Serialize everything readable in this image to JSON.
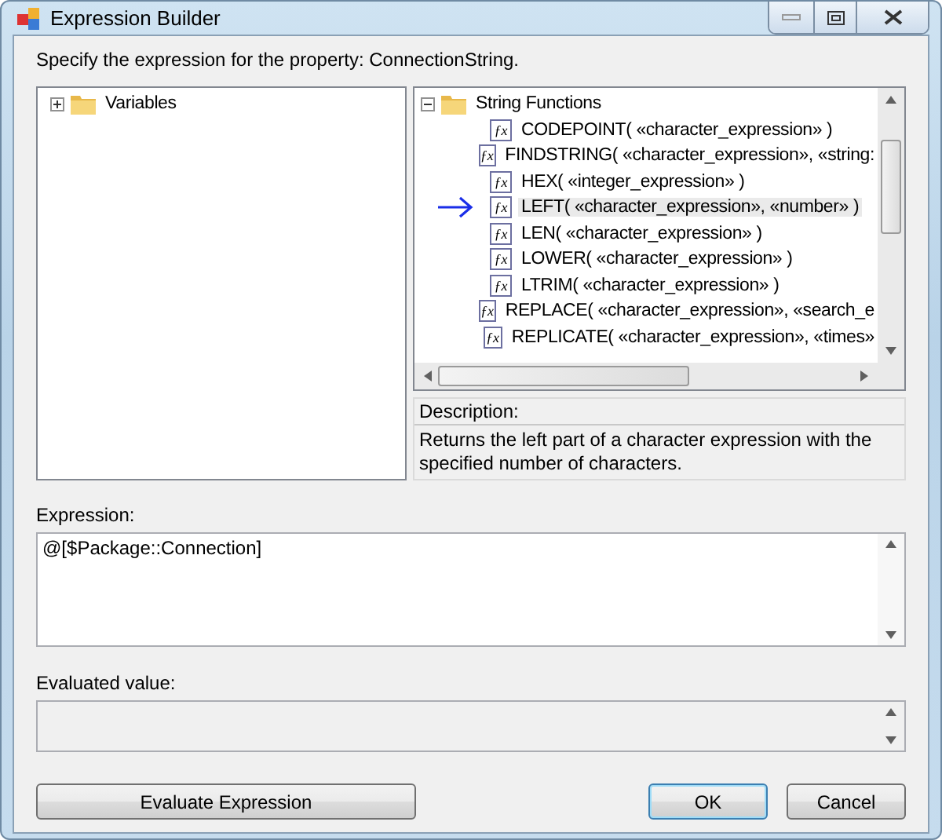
{
  "window": {
    "title": "Expression Builder"
  },
  "instruction": "Specify the expression for the property: ConnectionString.",
  "variables_tree": [
    {
      "label": "Variables",
      "expanded": false
    }
  ],
  "functions_tree": {
    "label": "String Functions",
    "expanded": true,
    "items": [
      {
        "icon": "ƒx",
        "label": "CODEPOINT( «character_expression» )",
        "selected": false
      },
      {
        "icon": "ƒx",
        "label": "FINDSTRING( «character_expression», «string:",
        "selected": false
      },
      {
        "icon": "ƒx",
        "label": "HEX( «integer_expression» )",
        "selected": false
      },
      {
        "icon": "ƒx",
        "label": "LEFT( «character_expression», «number» )",
        "selected": true
      },
      {
        "icon": "ƒx",
        "label": "LEN( «character_expression» )",
        "selected": false
      },
      {
        "icon": "ƒx",
        "label": "LOWER( «character_expression» )",
        "selected": false
      },
      {
        "icon": "ƒx",
        "label": "LTRIM( «character_expression» )",
        "selected": false
      },
      {
        "icon": "ƒx",
        "label": "REPLACE( «character_expression», «search_e",
        "selected": false
      },
      {
        "icon": "ƒx",
        "label": "REPLICATE( «character_expression», «times»",
        "selected": false
      }
    ]
  },
  "description": {
    "label": "Description:",
    "text": "Returns the left part of a character expression with the specified number of characters."
  },
  "expression": {
    "label": "Expression:",
    "value": "@[$Package::Connection]"
  },
  "evaluated": {
    "label": "Evaluated value:",
    "disabled": true
  },
  "buttons": [
    {
      "label": "Evaluate Expression",
      "default": false
    },
    {
      "label": "OK",
      "default": true
    },
    {
      "label": "Cancel",
      "default": false
    }
  ]
}
